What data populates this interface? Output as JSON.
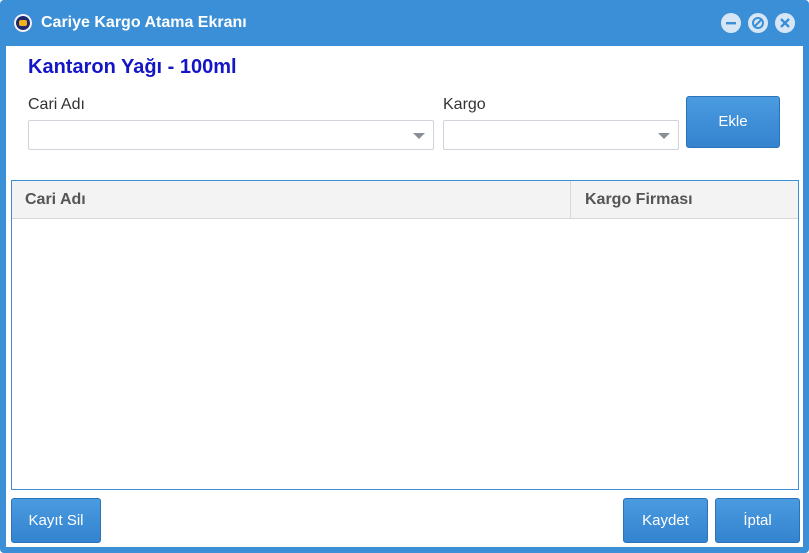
{
  "window": {
    "title": "Cariye Kargo Atama Ekranı",
    "accent_color": "#3a8fd6",
    "controls": [
      "minimize-icon",
      "maximize-icon",
      "close-icon"
    ]
  },
  "product": {
    "name": "Kantaron Yağı - 100ml",
    "color": "#1515c8"
  },
  "form": {
    "cari_label": "Cari Adı",
    "cari_value": "",
    "kargo_label": "Kargo",
    "kargo_value": "",
    "add_button": "Ekle"
  },
  "grid": {
    "columns": [
      "Cari Adı",
      "Kargo Firması"
    ],
    "rows": []
  },
  "footer": {
    "delete_button": "Kayıt Sil",
    "save_button": "Kaydet",
    "cancel_button": "İptal"
  }
}
